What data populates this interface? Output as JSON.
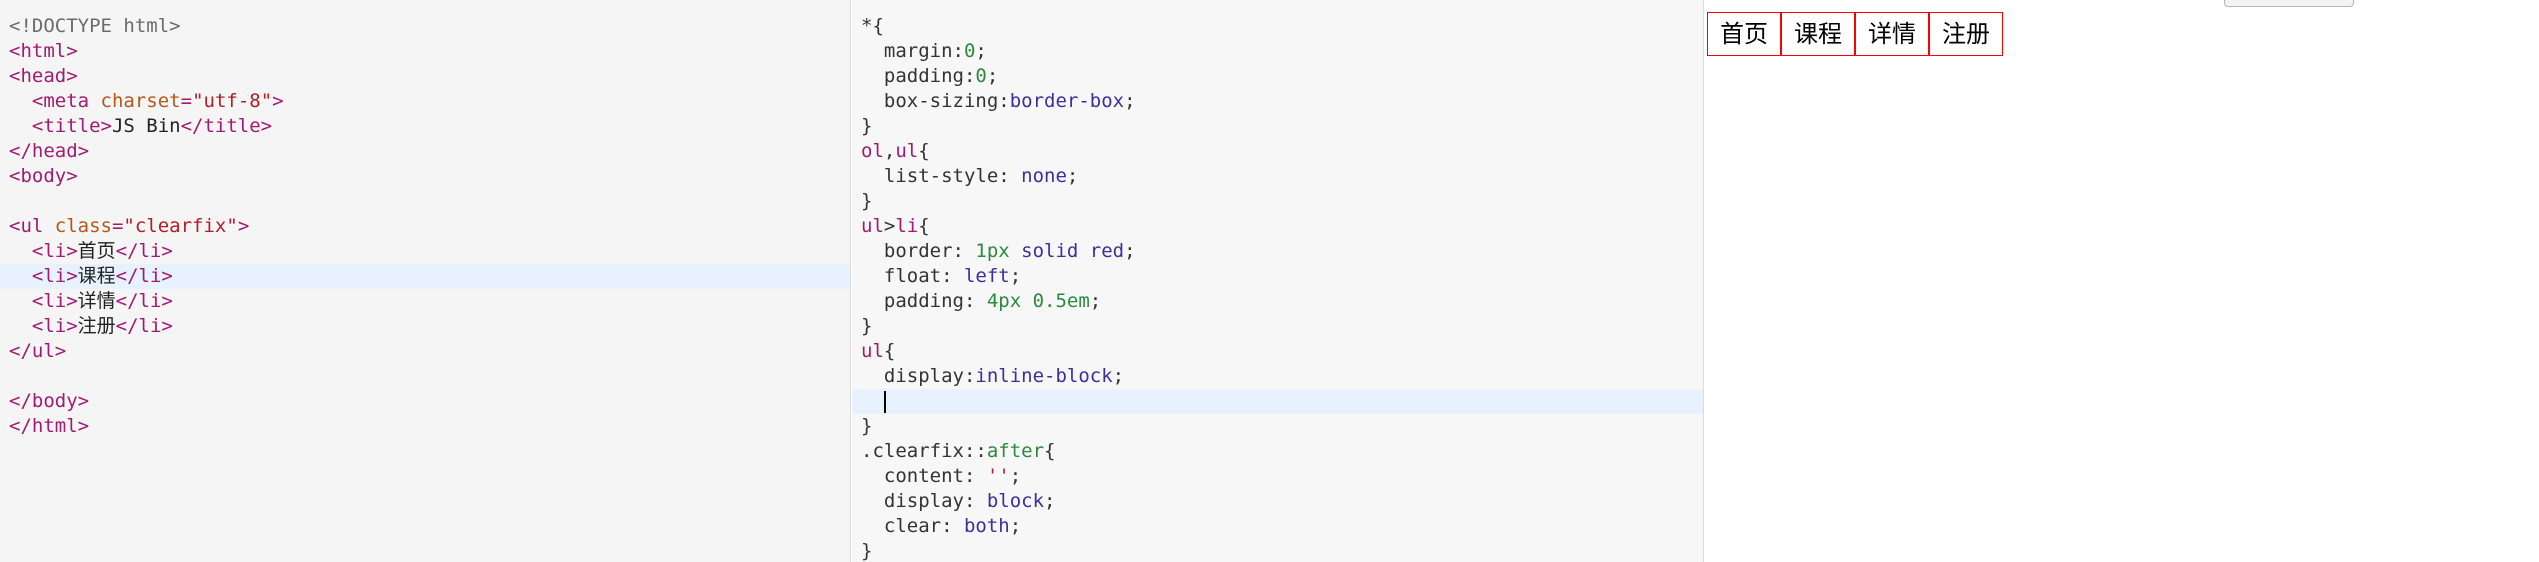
{
  "html_pane": {
    "lines": [
      {
        "tokens": [
          {
            "t": "doctype",
            "v": "<!DOCTYPE html>"
          }
        ]
      },
      {
        "tokens": [
          {
            "t": "tag",
            "v": "<html>"
          }
        ]
      },
      {
        "tokens": [
          {
            "t": "tag",
            "v": "<head>"
          }
        ]
      },
      {
        "tokens": [
          {
            "t": "text",
            "v": "  "
          },
          {
            "t": "tag",
            "v": "<meta "
          },
          {
            "t": "attr",
            "v": "charset"
          },
          {
            "t": "tag",
            "v": "="
          },
          {
            "t": "str",
            "v": "\"utf-8\""
          },
          {
            "t": "tag",
            "v": ">"
          }
        ]
      },
      {
        "tokens": [
          {
            "t": "text",
            "v": "  "
          },
          {
            "t": "tag",
            "v": "<title>"
          },
          {
            "t": "text",
            "v": "JS Bin"
          },
          {
            "t": "tag",
            "v": "</title>"
          }
        ]
      },
      {
        "tokens": [
          {
            "t": "tag",
            "v": "</head>"
          }
        ]
      },
      {
        "tokens": [
          {
            "t": "tag",
            "v": "<body>"
          }
        ]
      },
      {
        "tokens": []
      },
      {
        "tokens": [
          {
            "t": "tag",
            "v": "<ul "
          },
          {
            "t": "attr",
            "v": "class"
          },
          {
            "t": "tag",
            "v": "="
          },
          {
            "t": "str",
            "v": "\"clearfix\""
          },
          {
            "t": "tag",
            "v": ">"
          }
        ]
      },
      {
        "tokens": [
          {
            "t": "text",
            "v": "  "
          },
          {
            "t": "tag",
            "v": "<li>"
          },
          {
            "t": "text",
            "v": "首页"
          },
          {
            "t": "tag",
            "v": "</li>"
          }
        ]
      },
      {
        "tokens": [
          {
            "t": "text",
            "v": "  "
          },
          {
            "t": "tag",
            "v": "<li>"
          },
          {
            "t": "text",
            "v": "课程"
          },
          {
            "t": "tag",
            "v": "</li>"
          }
        ],
        "active": true
      },
      {
        "tokens": [
          {
            "t": "text",
            "v": "  "
          },
          {
            "t": "tag",
            "v": "<li>"
          },
          {
            "t": "text",
            "v": "详情"
          },
          {
            "t": "tag",
            "v": "</li>"
          }
        ]
      },
      {
        "tokens": [
          {
            "t": "text",
            "v": "  "
          },
          {
            "t": "tag",
            "v": "<li>"
          },
          {
            "t": "text",
            "v": "注册"
          },
          {
            "t": "tag",
            "v": "</li>"
          }
        ]
      },
      {
        "tokens": [
          {
            "t": "tag",
            "v": "</ul>"
          }
        ]
      },
      {
        "tokens": []
      },
      {
        "tokens": [
          {
            "t": "tag",
            "v": "</body>"
          }
        ]
      },
      {
        "tokens": [
          {
            "t": "tag",
            "v": "</html>"
          }
        ]
      }
    ]
  },
  "css_pane": {
    "lines": [
      {
        "tokens": [
          {
            "t": "punc",
            "v": "*{"
          }
        ]
      },
      {
        "tokens": [
          {
            "t": "prop",
            "v": "  margin:"
          },
          {
            "t": "num",
            "v": "0"
          },
          {
            "t": "punc",
            "v": ";"
          }
        ]
      },
      {
        "tokens": [
          {
            "t": "prop",
            "v": "  padding:"
          },
          {
            "t": "num",
            "v": "0"
          },
          {
            "t": "punc",
            "v": ";"
          }
        ]
      },
      {
        "tokens": [
          {
            "t": "prop",
            "v": "  box-sizing:"
          },
          {
            "t": "kw",
            "v": "border-box"
          },
          {
            "t": "punc",
            "v": ";"
          }
        ]
      },
      {
        "tokens": [
          {
            "t": "punc",
            "v": "}"
          }
        ]
      },
      {
        "tokens": [
          {
            "t": "sel",
            "v": "ol"
          },
          {
            "t": "punc",
            "v": ","
          },
          {
            "t": "sel",
            "v": "ul"
          },
          {
            "t": "punc",
            "v": "{"
          }
        ]
      },
      {
        "tokens": [
          {
            "t": "prop",
            "v": "  list-style: "
          },
          {
            "t": "kw",
            "v": "none"
          },
          {
            "t": "punc",
            "v": ";"
          }
        ]
      },
      {
        "tokens": [
          {
            "t": "punc",
            "v": "}"
          }
        ]
      },
      {
        "tokens": [
          {
            "t": "sel",
            "v": "ul"
          },
          {
            "t": "punc",
            "v": ">"
          },
          {
            "t": "sel",
            "v": "li"
          },
          {
            "t": "punc",
            "v": "{"
          }
        ]
      },
      {
        "tokens": [
          {
            "t": "prop",
            "v": "  border: "
          },
          {
            "t": "num",
            "v": "1px"
          },
          {
            "t": "kw",
            "v": " solid red"
          },
          {
            "t": "punc",
            "v": ";"
          }
        ]
      },
      {
        "tokens": [
          {
            "t": "prop",
            "v": "  float: "
          },
          {
            "t": "kw",
            "v": "left"
          },
          {
            "t": "punc",
            "v": ";"
          }
        ]
      },
      {
        "tokens": [
          {
            "t": "prop",
            "v": "  padding: "
          },
          {
            "t": "num",
            "v": "4px 0.5em"
          },
          {
            "t": "punc",
            "v": ";"
          }
        ]
      },
      {
        "tokens": [
          {
            "t": "punc",
            "v": "}"
          }
        ]
      },
      {
        "tokens": [
          {
            "t": "sel",
            "v": "ul"
          },
          {
            "t": "punc",
            "v": "{"
          }
        ]
      },
      {
        "tokens": [
          {
            "t": "prop",
            "v": "  display:"
          },
          {
            "t": "kw",
            "v": "inline-block"
          },
          {
            "t": "punc",
            "v": ";"
          }
        ]
      },
      {
        "tokens": [
          {
            "t": "prop",
            "v": "  "
          }
        ],
        "active": true,
        "cursor": true
      },
      {
        "tokens": [
          {
            "t": "punc",
            "v": "}"
          }
        ]
      },
      {
        "tokens": [
          {
            "t": "prop",
            "v": ".clearfix::"
          },
          {
            "t": "pseudo",
            "v": "after"
          },
          {
            "t": "punc",
            "v": "{"
          }
        ]
      },
      {
        "tokens": [
          {
            "t": "prop",
            "v": "  content: "
          },
          {
            "t": "str",
            "v": "''"
          },
          {
            "t": "punc",
            "v": ";"
          }
        ]
      },
      {
        "tokens": [
          {
            "t": "prop",
            "v": "  display: "
          },
          {
            "t": "kw",
            "v": "block"
          },
          {
            "t": "punc",
            "v": ";"
          }
        ]
      },
      {
        "tokens": [
          {
            "t": "prop",
            "v": "  clear: "
          },
          {
            "t": "kw",
            "v": "both"
          },
          {
            "t": "punc",
            "v": ";"
          }
        ]
      },
      {
        "tokens": [
          {
            "t": "punc",
            "v": "}"
          }
        ]
      }
    ]
  },
  "output": {
    "nav_items": [
      "首页",
      "课程",
      "详情",
      "注册"
    ]
  }
}
